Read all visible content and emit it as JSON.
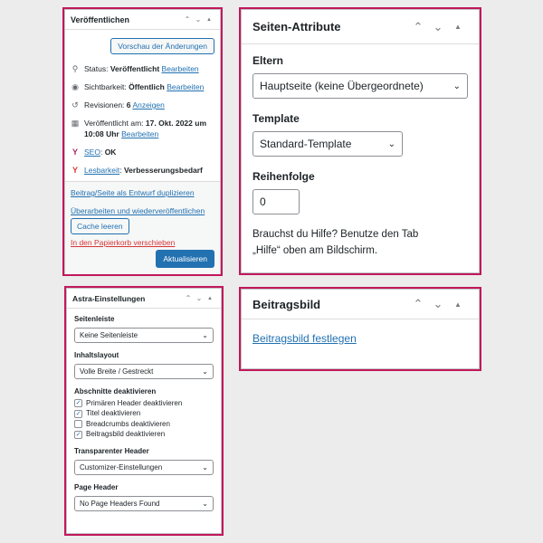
{
  "published": {
    "title": "Veröffentlichen",
    "preview_button": "Vorschau der Änderungen",
    "status_label": "Status:",
    "status_value": "Veröffentlicht",
    "status_edit": "Bearbeiten",
    "visibility_label": "Sichtbarkeit:",
    "visibility_value": "Öffentlich",
    "visibility_edit": "Bearbeiten",
    "revisions_label": "Revisionen:",
    "revisions_value": "6",
    "revisions_link": "Anzeigen",
    "published_on_label": "Veröffentlicht am:",
    "published_on_value": "17. Okt. 2022 um 10:08 Uhr",
    "published_on_edit": "Bearbeiten",
    "seo_label": "SEO",
    "seo_value": "OK",
    "readability_label": "Lesbarkeit",
    "readability_value": "Verbesserungsbedarf",
    "duplicate_link": "Beitrag/Seite als Entwurf duplizieren",
    "republish_link": "Überarbeiten und wiederveröffentlichen",
    "cache_button": "Cache leeren",
    "trash_link": "In den Papierkorb verschieben",
    "update_button": "Aktualisieren"
  },
  "page_attributes": {
    "title": "Seiten-Attribute",
    "parent_label": "Eltern",
    "parent_value": "Hauptseite (keine Übergeordnete)",
    "template_label": "Template",
    "template_value": "Standard-Template",
    "order_label": "Reihenfolge",
    "order_value": "0",
    "help_line1": "Brauchst du Hilfe? Benutze den Tab",
    "help_line2": "„Hilfe“ oben am Bildschirm."
  },
  "featured_image": {
    "title": "Beitragsbild",
    "set_link": "Beitragsbild festlegen"
  },
  "astra": {
    "title": "Astra-Einstellungen",
    "sidebar_label": "Seitenleiste",
    "sidebar_value": "Keine Seitenleiste",
    "content_layout_label": "Inhaltslayout",
    "content_layout_value": "Volle Breite / Gestreckt",
    "disable_sections_label": "Abschnitte deaktivieren",
    "checkboxes": [
      {
        "label": "Primären Header deaktivieren",
        "checked": true
      },
      {
        "label": "Titel deaktivieren",
        "checked": true
      },
      {
        "label": "Breadcrumbs deaktivieren",
        "checked": false
      },
      {
        "label": "Beitragsbild deaktivieren",
        "checked": true
      }
    ],
    "transparent_header_label": "Transparenter Header",
    "transparent_header_value": "Customizer-Einstellungen",
    "page_header_label": "Page Header",
    "page_header_value": "No Page Headers Found"
  },
  "colors": {
    "highlight": "#c2185b",
    "link": "#2271b1",
    "trash": "#d63638"
  }
}
